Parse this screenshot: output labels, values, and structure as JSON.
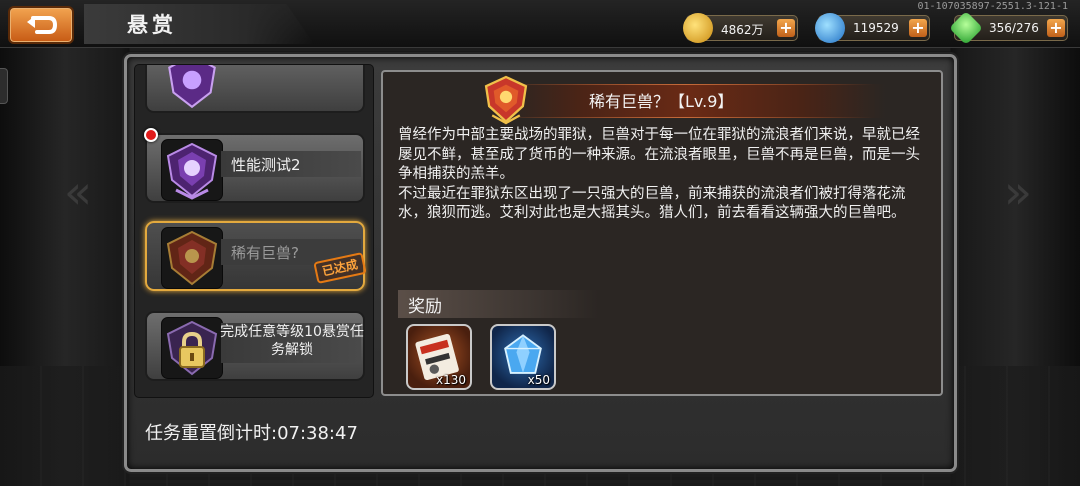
{
  "header": {
    "title": "悬赏",
    "build_id": "01-107035897-2551.3-121-1"
  },
  "resources": [
    {
      "name": "gold",
      "value": "4862万",
      "icon": "gold-coin-icon",
      "color": "#e8b020"
    },
    {
      "name": "crystal",
      "value": "119529",
      "icon": "blue-crystal-icon",
      "color": "#2f8fe0"
    },
    {
      "name": "energy",
      "value": "356/276",
      "icon": "green-energy-icon",
      "color": "#3fc24a"
    }
  ],
  "quest_list": [
    {
      "label": "",
      "state": "normal",
      "emblem": "purple-emblem-icon"
    },
    {
      "label": "性能测试2",
      "state": "normal",
      "emblem": "purple-emblem-icon",
      "badge": "new"
    },
    {
      "label": "稀有巨兽?",
      "state": "completed",
      "emblem": "red-gold-emblem-icon",
      "stamp": "已达成"
    },
    {
      "label": "完成任意等级10悬赏任务解锁",
      "state": "locked",
      "emblem": "lock-icon"
    }
  ],
  "detail": {
    "title": "稀有巨兽？【Lv.9】",
    "description": "曾经作为中部主要战场的罪狱，巨兽对于每一位在罪狱的流浪者们来说，早就已经屡见不鲜，甚至成了货币的一种来源。在流浪者眼里，巨兽不再是巨兽，而是一头争相捕获的羔羊。\n不过最近在罪狱东区出现了一只强大的巨兽，前来捕获的流浪者们被打得落花流水，狼狈而逃。艾利对此也是大摇其头。猎人们，前去看看这辆强大的巨兽吧。",
    "rewards_label": "奖励",
    "rewards": [
      {
        "icon": "coupon-ticket-icon",
        "qty": "x130"
      },
      {
        "icon": "blue-gem-icon",
        "qty": "x50"
      }
    ]
  },
  "footer": {
    "reset_timer": "任务重置倒计时:07:38:47"
  }
}
